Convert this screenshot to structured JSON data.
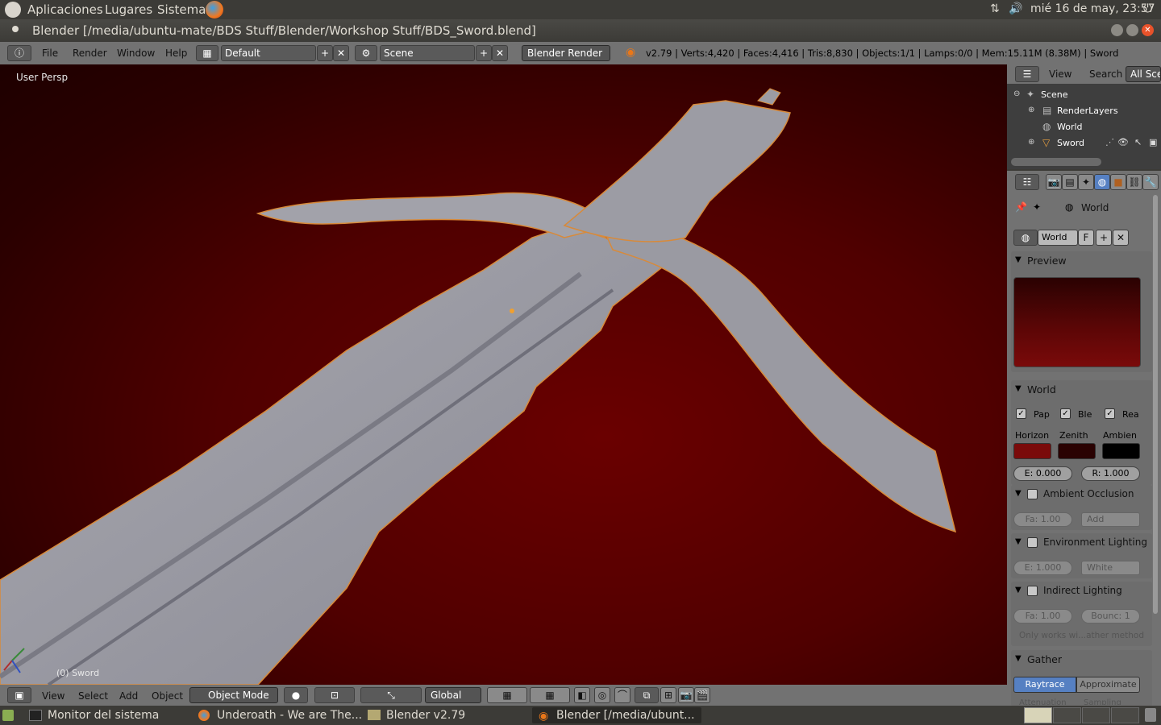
{
  "panel": {
    "apps": "Aplicaciones",
    "places": "Lugares",
    "system": "Sistema",
    "clock": "mié 16 de may, 23:57"
  },
  "window": {
    "title": "Blender [/media/ubuntu-mate/BDS Stuff/Blender/Workshop Stuff/BDS_Sword.blend]"
  },
  "info": {
    "menus": [
      "File",
      "Render",
      "Window",
      "Help"
    ],
    "layout": "Default",
    "scene": "Scene",
    "engine": "Blender Render",
    "stats": "v2.79 | Verts:4,420 | Faces:4,416 | Tris:8,830 | Objects:1/1 | Lamps:0/0 | Mem:15.11M (8.38M) | Sword"
  },
  "viewport": {
    "view_label": "User Persp",
    "object_label": "(0) Sword"
  },
  "view_header": {
    "menus": [
      "View",
      "Select",
      "Add",
      "Object"
    ],
    "mode": "Object Mode",
    "orientation": "Global"
  },
  "outliner": {
    "menus": [
      "View",
      "Search",
      "All Scen"
    ],
    "items": [
      "Scene",
      "RenderLayers",
      "World",
      "Sword"
    ]
  },
  "props": {
    "context": "World",
    "datablock": "World",
    "fake_user": "F",
    "preview_title": "Preview",
    "world_panel": "World",
    "checks": [
      "Pap",
      "Ble",
      "Rea"
    ],
    "colors_labels": [
      "Horizon",
      "Zenith",
      "Ambien"
    ],
    "colors": {
      "horizon": "#7a0a0a",
      "zenith": "#2a0202",
      "ambient": "#000000"
    },
    "exposure": "E: 0.000",
    "range": "R: 1.000",
    "ao_title": "Ambient Occlusion",
    "ao_factor": "Fa: 1.00",
    "ao_blend": "Add",
    "env_title": "Environment Lighting",
    "env_energy": "E: 1.000",
    "env_color": "White",
    "ind_title": "Indirect Lighting",
    "ind_factor": "Fa: 1.00",
    "ind_bounce": "Bounc: 1",
    "ind_note": "Only works wi...ather method",
    "gather_title": "Gather",
    "gather_raytrace": "Raytrace",
    "gather_approx": "Approximate",
    "gather_more": [
      "Attenuation",
      "Sampling"
    ]
  },
  "taskbar": {
    "items": [
      "Monitor del sistema",
      "Underoath - We are The...",
      "Blender v2.79",
      "Blender [/media/ubunt..."
    ]
  }
}
